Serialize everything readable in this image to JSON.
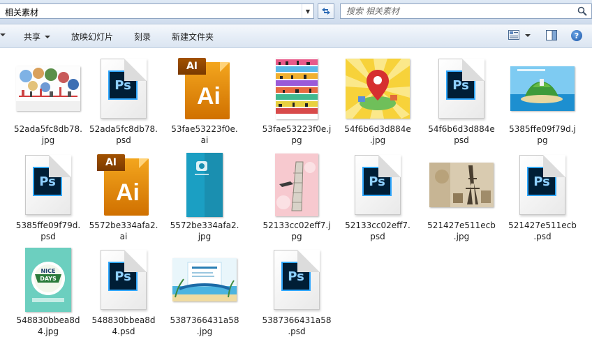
{
  "address": {
    "path": "相关素材"
  },
  "search": {
    "placeholder": "搜索 相关素材"
  },
  "toolbar": {
    "share": "共享",
    "slideshow": "放映幻灯片",
    "burn": "刻录",
    "new_folder": "新建文件夹"
  },
  "colors": {
    "chrome": "#dbe5f1",
    "ps_blue": "#31a8ff",
    "ai_orange": "#f3a61e"
  },
  "files": [
    {
      "name_line1": "52ada5fc8db78.",
      "name_line2": "jpg",
      "kind": "image"
    },
    {
      "name_line1": "52ada5fc8db78.",
      "name_line2": "psd",
      "kind": "psd"
    },
    {
      "name_line1": "53fae53223f0e.",
      "name_line2": "ai",
      "kind": "ai"
    },
    {
      "name_line1": "53fae53223f0e.j",
      "name_line2": "pg",
      "kind": "image"
    },
    {
      "name_line1": "54f6b6d3d884e",
      "name_line2": ".jpg",
      "kind": "image"
    },
    {
      "name_line1": "54f6b6d3d884e",
      "name_line2": "psd",
      "kind": "psd"
    },
    {
      "name_line1": "5385ffe09f79d.j",
      "name_line2": "pg",
      "kind": "image"
    },
    {
      "name_line1": "5385ffe09f79d.",
      "name_line2": "psd",
      "kind": "psd"
    },
    {
      "name_line1": "5572be334afa2.",
      "name_line2": "ai",
      "kind": "ai"
    },
    {
      "name_line1": "5572be334afa2.",
      "name_line2": "jpg",
      "kind": "image"
    },
    {
      "name_line1": "52133cc02eff7.j",
      "name_line2": "pg",
      "kind": "image"
    },
    {
      "name_line1": "52133cc02eff7.",
      "name_line2": "psd",
      "kind": "psd"
    },
    {
      "name_line1": "521427e511ecb",
      "name_line2": ".jpg",
      "kind": "image"
    },
    {
      "name_line1": "521427e511ecb",
      "name_line2": ".psd",
      "kind": "psd"
    },
    {
      "name_line1": "548830bbea8d",
      "name_line2": "4.jpg",
      "kind": "image"
    },
    {
      "name_line1": "548830bbea8d",
      "name_line2": "4.psd",
      "kind": "psd"
    },
    {
      "name_line1": "5387366431a58",
      "name_line2": ".jpg",
      "kind": "image"
    },
    {
      "name_line1": "5387366431a58",
      "name_line2": ".psd",
      "kind": "psd"
    }
  ],
  "icons": {
    "ps_text": "Ps",
    "ai_tab": "AI",
    "ai_big": "Ai",
    "nice_days": "NICE DAYS"
  }
}
